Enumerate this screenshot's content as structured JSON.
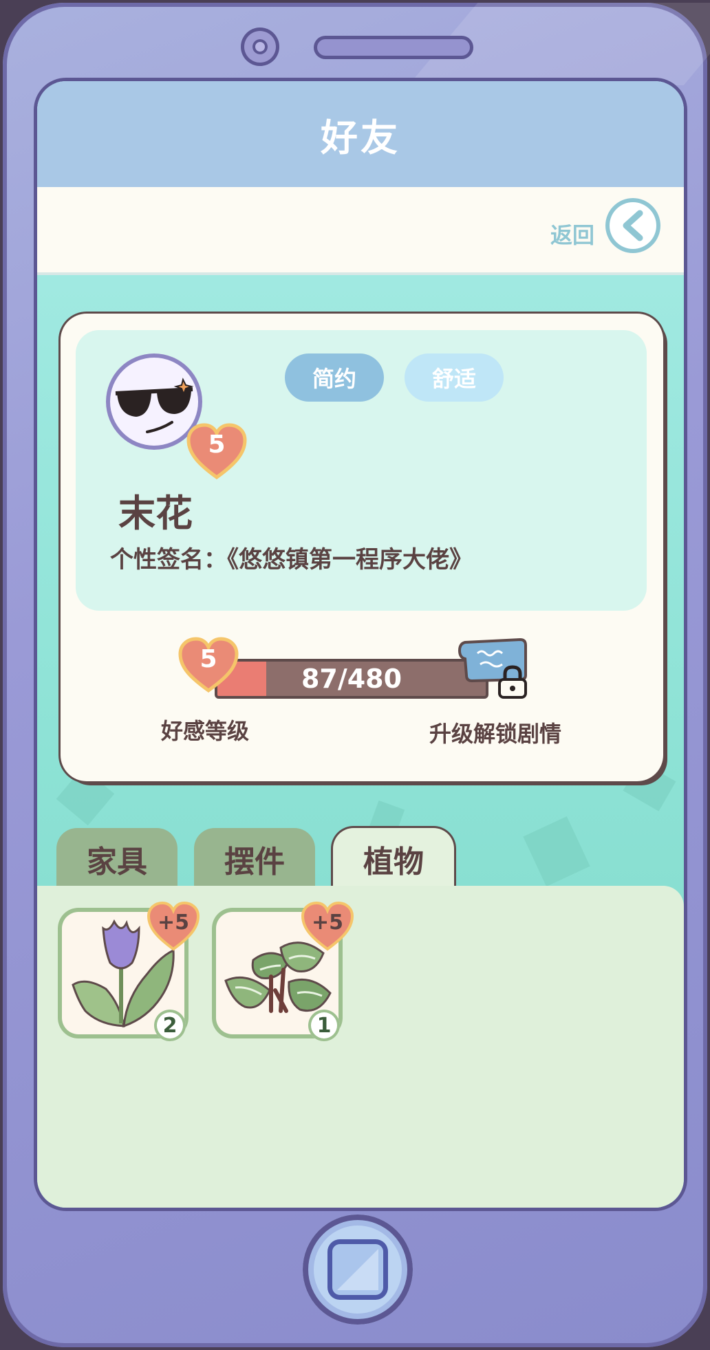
{
  "header": {
    "title": "好友"
  },
  "subbar": {
    "back_label": "返回"
  },
  "profile": {
    "level": "5",
    "tags": [
      "简约",
      "舒适"
    ],
    "name": "末花",
    "signature": "个性签名：《悠悠镇第一程序大佬》"
  },
  "affection": {
    "level": "5",
    "progress_text": "87/480",
    "progress_fraction": 0.181,
    "level_label": "好感等级",
    "unlock_label": "升级解锁剧情"
  },
  "tabs": [
    {
      "label": "家具",
      "active": false
    },
    {
      "label": "摆件",
      "active": false
    },
    {
      "label": "植物",
      "active": true
    }
  ],
  "items": [
    {
      "name": "tulip",
      "bonus": "+5",
      "count": "2"
    },
    {
      "name": "leafy-plant",
      "bonus": "+5",
      "count": "1"
    }
  ],
  "colors": {
    "header": "#a9c8e6",
    "heart": "#ea8b76",
    "bar_fill": "#ea7d73",
    "panel": "#dff0da"
  }
}
